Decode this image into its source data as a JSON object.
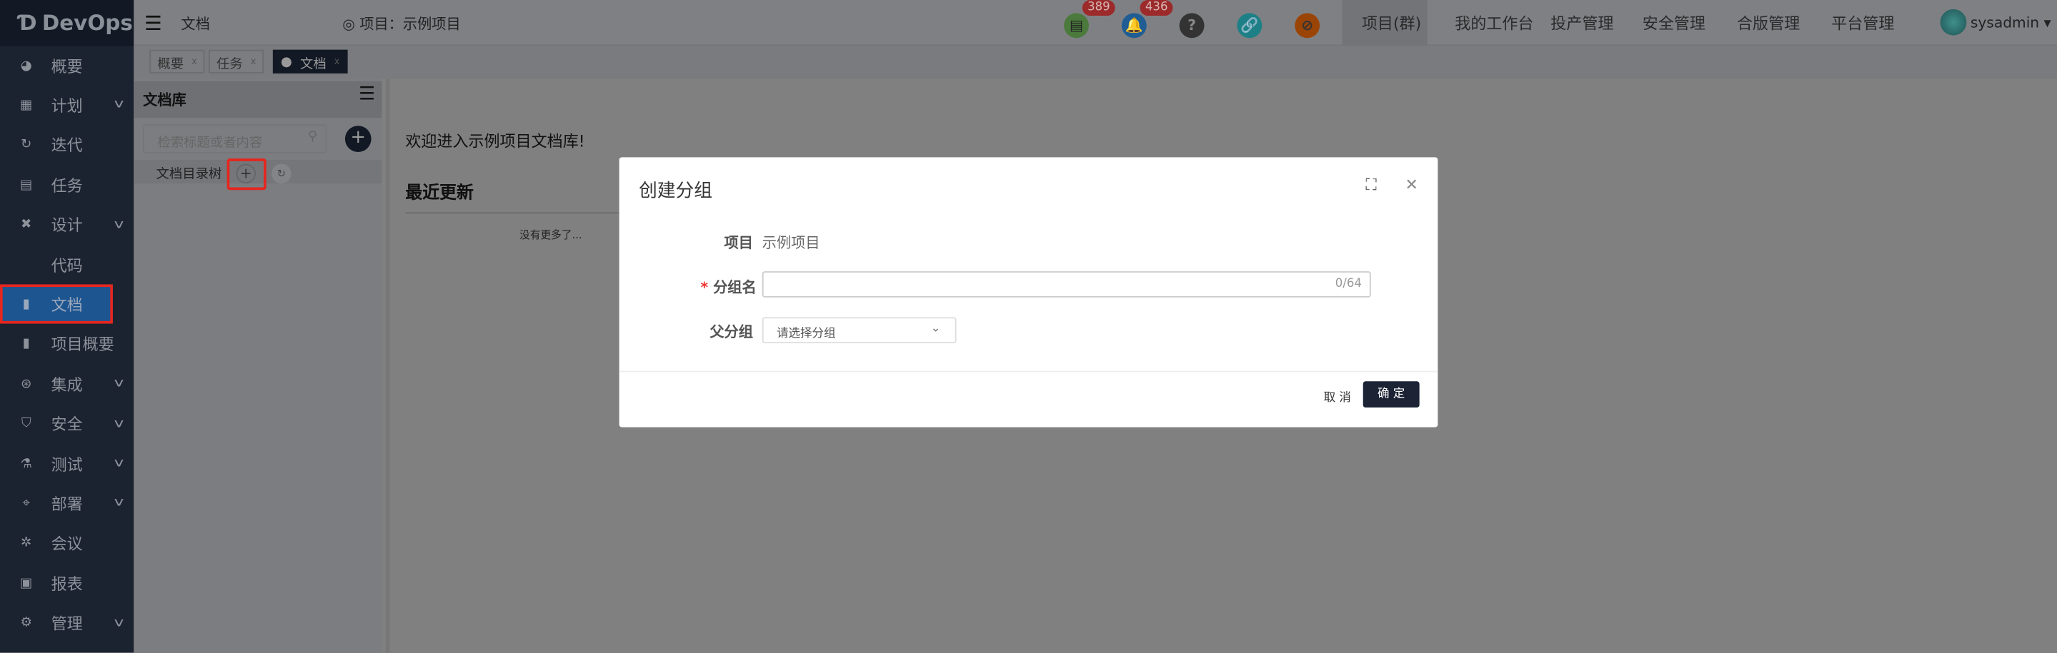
{
  "app": {
    "logo": "DevOps"
  },
  "sidebar": {
    "items": [
      {
        "label": "概要",
        "icon": "dashboard-icon",
        "chev": false
      },
      {
        "label": "计划",
        "icon": "plan-icon",
        "chev": true
      },
      {
        "label": "迭代",
        "icon": "iteration-icon",
        "chev": false
      },
      {
        "label": "任务",
        "icon": "task-icon",
        "chev": false
      },
      {
        "label": "设计",
        "icon": "design-icon",
        "chev": true
      },
      {
        "label": "代码",
        "icon": "code-icon",
        "chev": false
      },
      {
        "label": "文档",
        "icon": "document-icon",
        "chev": false,
        "active": true
      },
      {
        "label": "项目概要",
        "icon": "project-summary-icon",
        "chev": false
      },
      {
        "label": "集成",
        "icon": "integration-icon",
        "chev": true
      },
      {
        "label": "安全",
        "icon": "shield-icon",
        "chev": true
      },
      {
        "label": "测试",
        "icon": "flask-icon",
        "chev": true
      },
      {
        "label": "部署",
        "icon": "deploy-icon",
        "chev": true
      },
      {
        "label": "会议",
        "icon": "meeting-icon",
        "chev": false
      },
      {
        "label": "报表",
        "icon": "report-icon",
        "chev": false
      },
      {
        "label": "管理",
        "icon": "gear-icon",
        "chev": true
      }
    ]
  },
  "header": {
    "page": "文档",
    "project_label": "项目：示例项目",
    "badges": {
      "docs": "389",
      "notifications": "436"
    },
    "nav": [
      "项目(群)",
      "我的工作台",
      "投产管理",
      "安全管理",
      "合版管理",
      "平台管理"
    ],
    "user": "sysadmin"
  },
  "tabs": [
    "概要",
    "任务",
    "文档"
  ],
  "library": {
    "title": "文档库",
    "search_placeholder": "检索标题或者内容",
    "tree_label": "文档目录树"
  },
  "main": {
    "welcome": "欢迎进入示例项目文档库!",
    "recent_title": "最近更新",
    "no_more": "没有更多了..."
  },
  "modal": {
    "title": "创建分组",
    "project_label": "项目",
    "project_value": "示例项目",
    "name_label": "分组名",
    "name_value": "",
    "name_counter": "0/64",
    "parent_label": "父分组",
    "parent_placeholder": "请选择分组",
    "cancel": "取 消",
    "ok": "确 定"
  }
}
